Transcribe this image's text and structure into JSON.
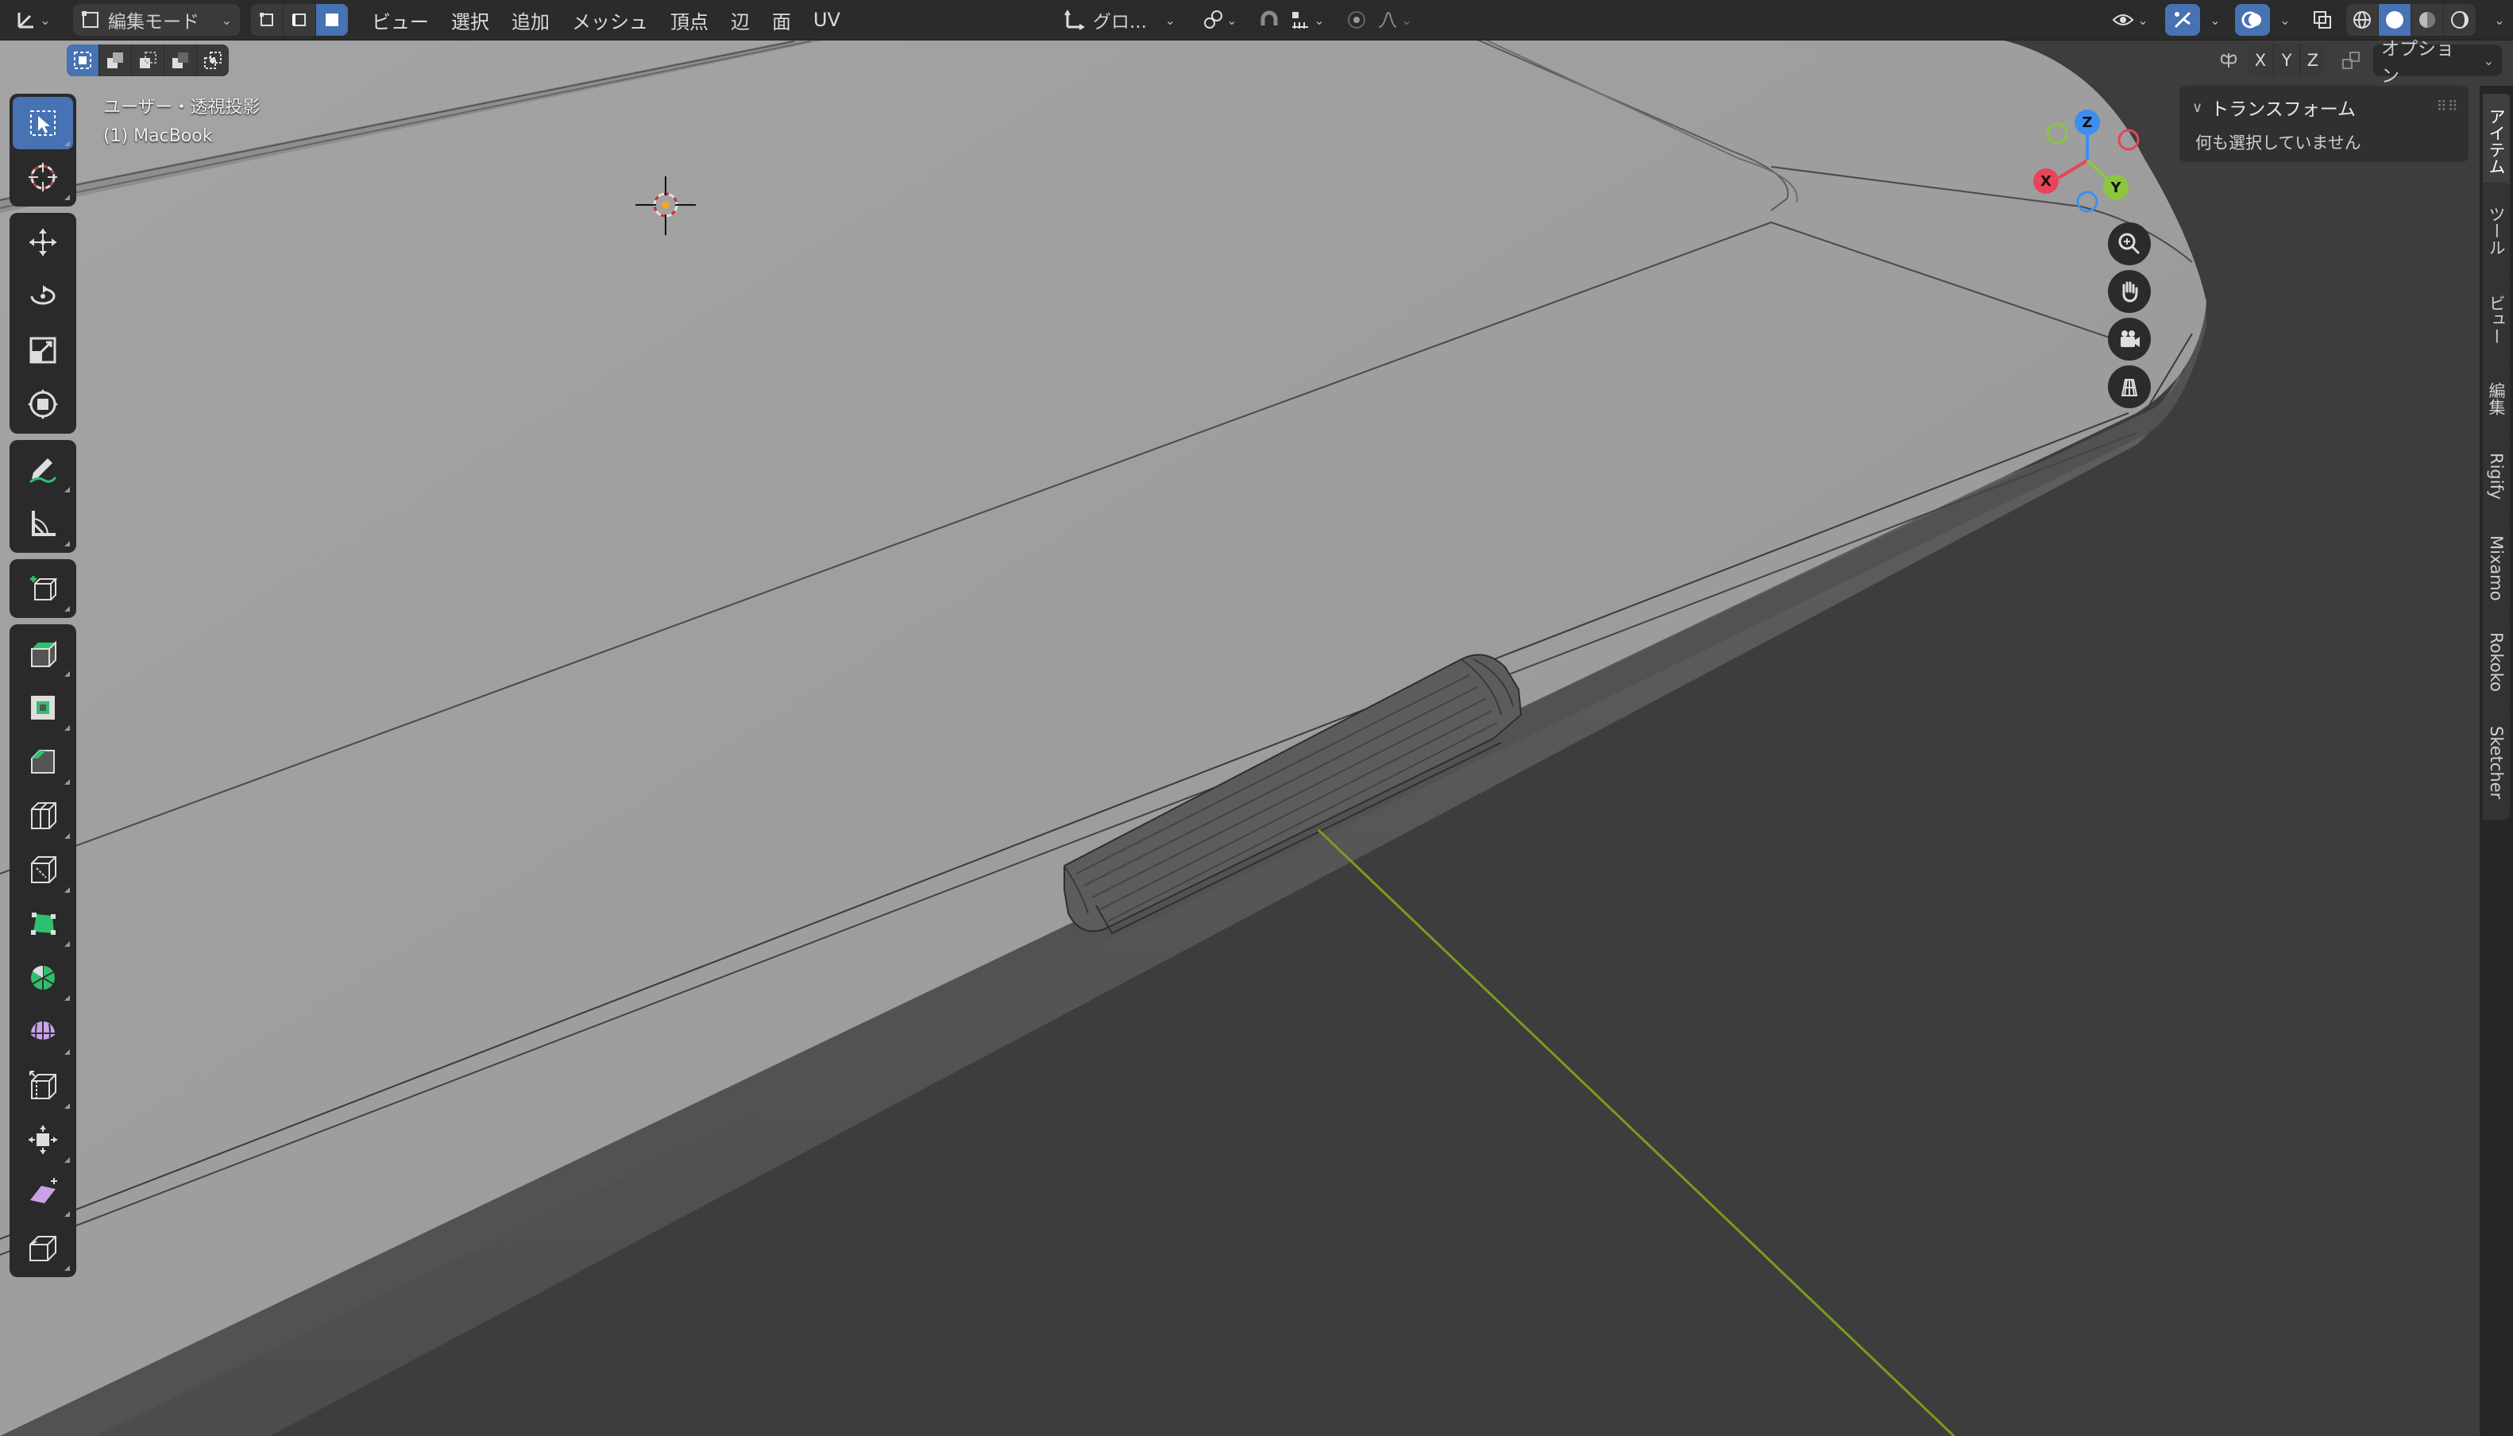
{
  "header": {
    "mode_label": "編集モード",
    "menus": [
      "ビュー",
      "選択",
      "追加",
      "メッシュ",
      "頂点",
      "辺",
      "面",
      "UV"
    ],
    "transform_orientation": "グロ...",
    "options_label": "オプション",
    "axis_labels": [
      "X",
      "Y",
      "Z"
    ]
  },
  "viewport": {
    "view_name": "ユーザー・透視投影",
    "object_name": "(1) MacBook"
  },
  "gizmo": {
    "x": "X",
    "y": "Y",
    "z": "Z"
  },
  "panel": {
    "title": "トランスフォーム",
    "body": "何も選択していません"
  },
  "side_tabs": [
    "アイテム",
    "ツール",
    "ビュー",
    "編集",
    "Rigify",
    "Mixamo",
    "Rokoko",
    "Sketcher"
  ],
  "icons": {
    "toolbar": [
      "select-box-icon",
      "cursor-icon",
      "move-icon",
      "rotate-icon",
      "scale-icon",
      "transform-icon",
      "annotate-icon",
      "measure-icon",
      "add-cube-icon",
      "extrude-icon",
      "inset-icon",
      "bevel-icon",
      "loop-cut-icon",
      "knife-icon",
      "poly-build-icon",
      "spin-icon",
      "smooth-icon",
      "edge-slide-icon",
      "shrink-fatten-icon",
      "shear-icon",
      "rip-icon"
    ]
  },
  "colors": {
    "accent": "#4772b3",
    "axis_x": "#e8445a",
    "axis_y": "#8cc63e",
    "axis_z": "#3e8ef0",
    "surface_top": "#9d9d9d",
    "surface_side": "#585858",
    "background": "#3d3d3d"
  }
}
